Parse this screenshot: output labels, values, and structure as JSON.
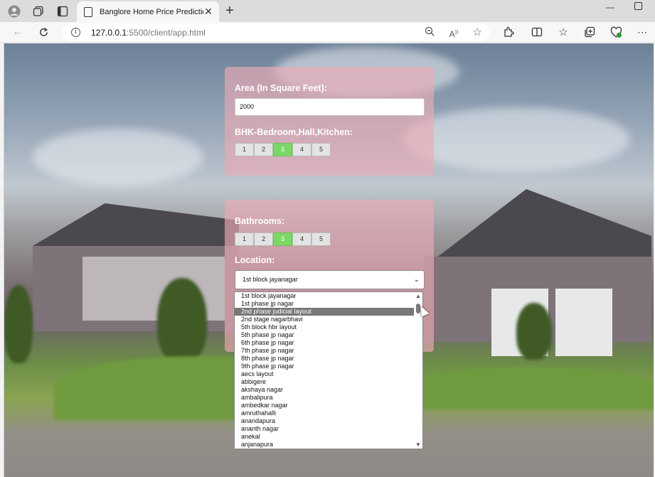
{
  "browser": {
    "tab_title": "Banglore Home Price Prediction",
    "url_host": "127.0.0.1",
    "url_rest": ":5500/client/app.html"
  },
  "form": {
    "area_label": "Area (In Square Feet):",
    "area_value": "2000",
    "bhk_label": "BHK-Bedroom,Hall,Kitchen:",
    "bhk_options": [
      "1",
      "2",
      "3",
      "4",
      "5"
    ],
    "bhk_selected": "3",
    "bath_label": "Bathrooms:",
    "bath_options": [
      "1",
      "2",
      "3",
      "4",
      "5"
    ],
    "bath_selected": "3",
    "location_label": "Location:",
    "location_value": "1st block jayanagar"
  },
  "dropdown": {
    "highlighted": "2nd phase judicial layout",
    "items": [
      "1st block jayanagar",
      "1st phase jp nagar",
      "2nd phase judicial layout",
      "2nd stage nagarbhavi",
      "5th block hbr layout",
      "5th phase jp nagar",
      "6th phase jp nagar",
      "7th phase jp nagar",
      "8th phase jp nagar",
      "9th phase jp nagar",
      "aecs layout",
      "abbigere",
      "akshaya nagar",
      "ambalipura",
      "ambedkar nagar",
      "amruthahalli",
      "anandapura",
      "ananth nagar",
      "anekal",
      "anjanapura"
    ]
  },
  "colors": {
    "accent_selected": "#7bd766",
    "card_bg": "#eaaab4"
  }
}
